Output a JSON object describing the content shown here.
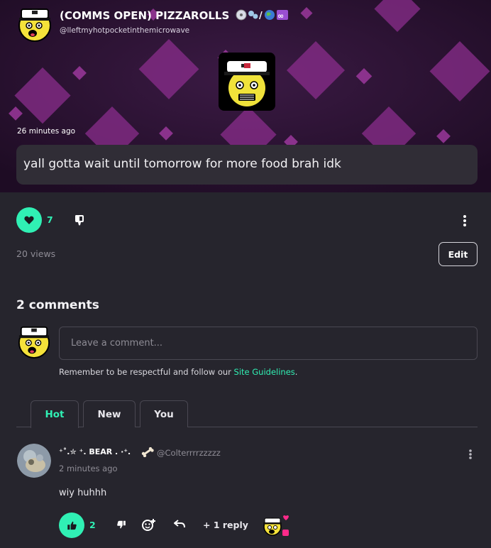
{
  "post": {
    "author_name": "(COMMS OPEN) PIZZAROLLS",
    "author_handle": "@lleftmyhotpocketinthemicrowave",
    "time_ago": "26 minutes ago",
    "text": "yall gotta wait until tomorrow for more food brah idk",
    "likes": "7",
    "views": "20 views",
    "edit_label": "Edit"
  },
  "comments_section": {
    "title": "2 comments",
    "input_placeholder": "Leave a comment...",
    "guidelines_prefix": "Remember to be respectful and follow our ",
    "guidelines_link": "Site Guidelines",
    "guidelines_suffix": ".",
    "tabs": [
      {
        "label": "Hot",
        "active": true
      },
      {
        "label": "New",
        "active": false
      },
      {
        "label": "You",
        "active": false
      }
    ]
  },
  "comment": {
    "author_name": "⁺˚.✮ ⁺. BEAR . ·⁺.",
    "author_handle": "@Colterrrrzzzzz",
    "time_ago": "2 minutes ago",
    "text": "wiy huhhh",
    "likes": "2",
    "replies": "+ 1 reply"
  },
  "colors": {
    "accent": "#30f0b4",
    "background": "#26252d",
    "banner": "#2a1330",
    "text_box": "#302d36"
  },
  "icons": {
    "like": "heart-icon",
    "dislike": "thumbs-down-icon",
    "more": "vertical-dots-icon",
    "comment_like": "thumbs-up-icon",
    "react": "add-reaction-icon",
    "reply": "reply-arrow-icon"
  }
}
